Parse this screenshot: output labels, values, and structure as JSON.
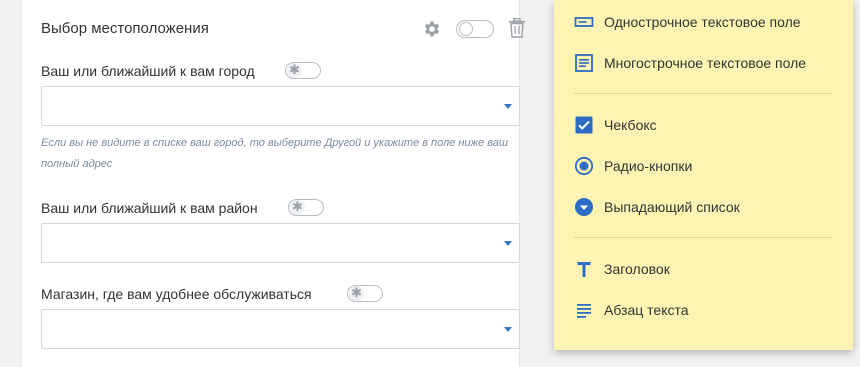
{
  "form": {
    "section_title": "Выбор местоположения",
    "fields": [
      {
        "label": "Ваш или ближайший к вам город",
        "value": ""
      },
      {
        "label": "Ваш или ближайший к вам район",
        "value": ""
      },
      {
        "label": "Магазин, где вам удобнее обслуживаться",
        "value": ""
      }
    ],
    "hint": "Если вы не видите в списке ваш город, то выберите Другой и укажите в поле ниже ваш полный адрес",
    "required_symbol": "✱"
  },
  "menu": {
    "items": [
      {
        "label": "Однострочное текстовое поле",
        "icon": "single-line-field-icon"
      },
      {
        "label": "Многострочное текстовое поле",
        "icon": "multi-line-field-icon"
      },
      {
        "label": "Чекбокс",
        "icon": "checkbox-icon"
      },
      {
        "label": "Радио-кнопки",
        "icon": "radio-icon"
      },
      {
        "label": "Выпадающий список",
        "icon": "dropdown-icon"
      },
      {
        "label": "Заголовок",
        "icon": "heading-icon"
      },
      {
        "label": "Абзац текста",
        "icon": "paragraph-icon"
      }
    ]
  },
  "colors": {
    "accent": "#2d6cc4",
    "menu_bg": "#fdf4b3",
    "hint": "#7a8a9c"
  }
}
